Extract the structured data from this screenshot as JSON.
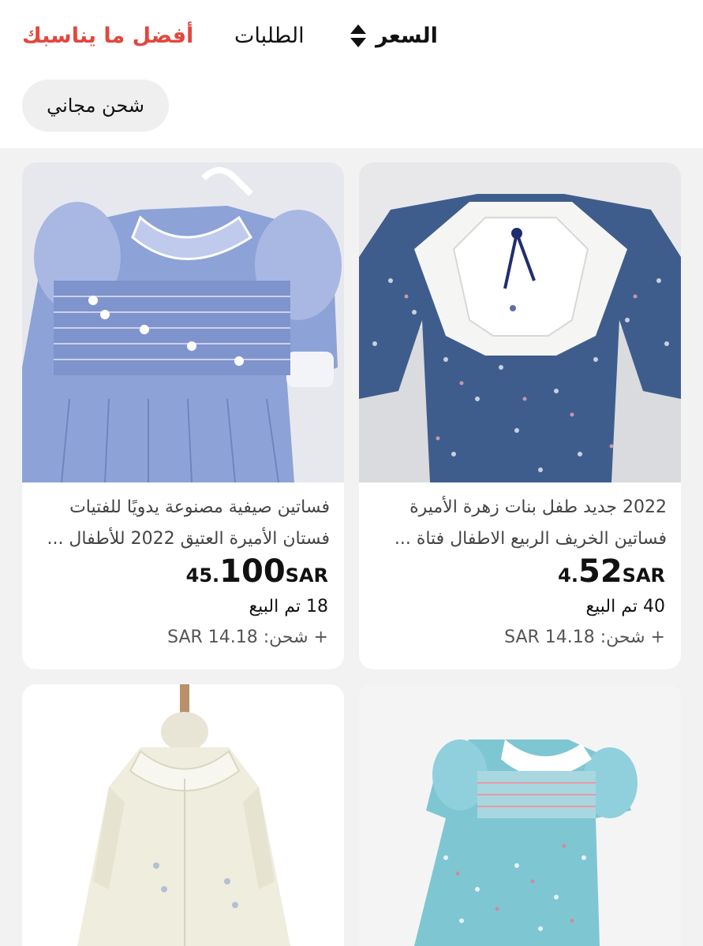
{
  "sort_bar": {
    "best_match": "أفضل ما يناسبك",
    "orders": "الطلبات",
    "price": "السعر"
  },
  "filters": {
    "free_shipping": "شحن مجاني"
  },
  "colors": {
    "accent": "#e2473e",
    "background": "#f2f2f2"
  },
  "products": [
    {
      "title_line1": "2022 جديد طفل بنات زهرة الأميرة",
      "title_line2": "فساتين الخريف الربيع الاطفال فتاة ...",
      "price_int": "4.",
      "price_dec": "52",
      "currency": "SAR",
      "sold": "40 تم البيع",
      "shipping": "+ شحن: SAR 14.18"
    },
    {
      "title_line1": "فساتين صيفية مصنوعة يدويًا للفتيات",
      "title_line2": "فستان الأميرة العتيق 2022 للأطفال ...",
      "price_int": "45.",
      "price_dec": "100",
      "currency": "SAR",
      "sold": "18 تم البيع",
      "shipping": "+ شحن: SAR 14.18"
    }
  ]
}
